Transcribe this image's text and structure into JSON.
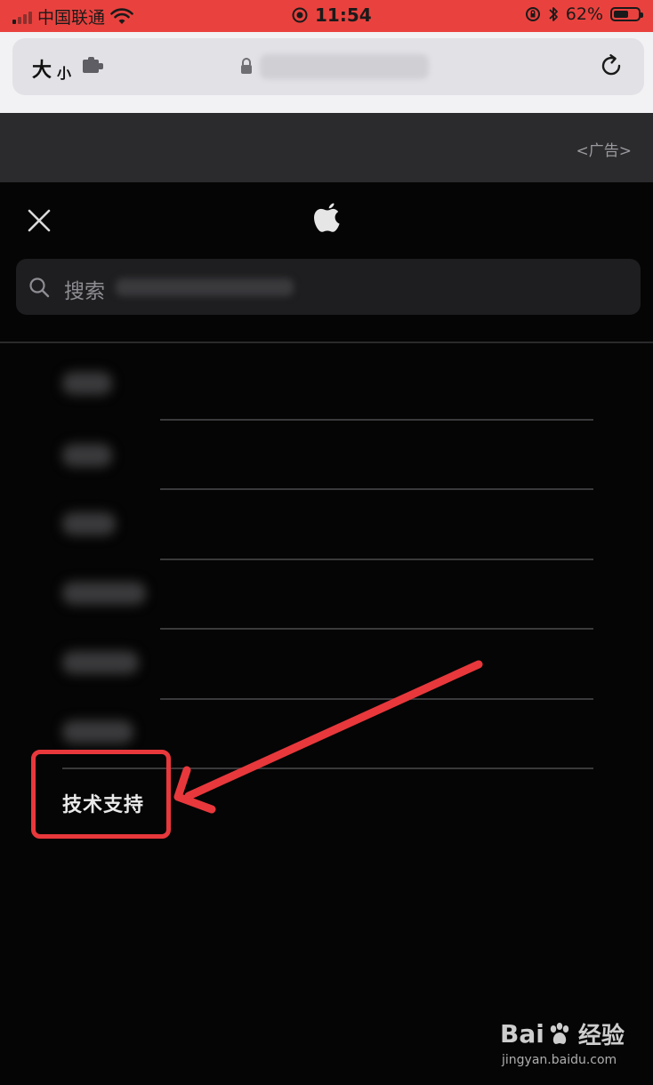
{
  "status_bar": {
    "carrier": "中国联通",
    "time": "11:54",
    "battery_percent": "62%",
    "battery_level": 0.62
  },
  "browser": {
    "text_size_label": "大",
    "text_size_small": "小"
  },
  "ad": {
    "label": "<广告>"
  },
  "search": {
    "placeholder": "搜索"
  },
  "menu": {
    "support_label": "技术支持"
  },
  "watermark": {
    "brand": "Bai",
    "brand_suffix": "经验",
    "url": "jingyan.baidu.com"
  },
  "colors": {
    "status_bar": "#e9423e",
    "annotation_red": "#e8383c",
    "background": "#050505"
  }
}
